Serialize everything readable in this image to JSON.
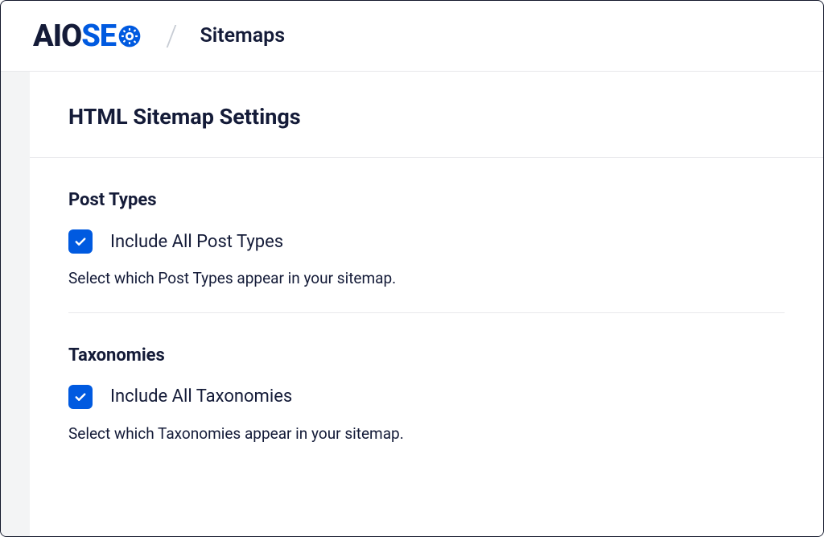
{
  "header": {
    "logo_aio": "AIO",
    "logo_se": "SE",
    "page_title": "Sitemaps"
  },
  "card": {
    "title": "HTML Sitemap Settings"
  },
  "sections": {
    "post_types": {
      "title": "Post Types",
      "checkbox_label": "Include All Post Types",
      "helper": "Select which Post Types appear in your sitemap."
    },
    "taxonomies": {
      "title": "Taxonomies",
      "checkbox_label": "Include All Taxonomies",
      "helper": "Select which Taxonomies appear in your sitemap."
    }
  }
}
